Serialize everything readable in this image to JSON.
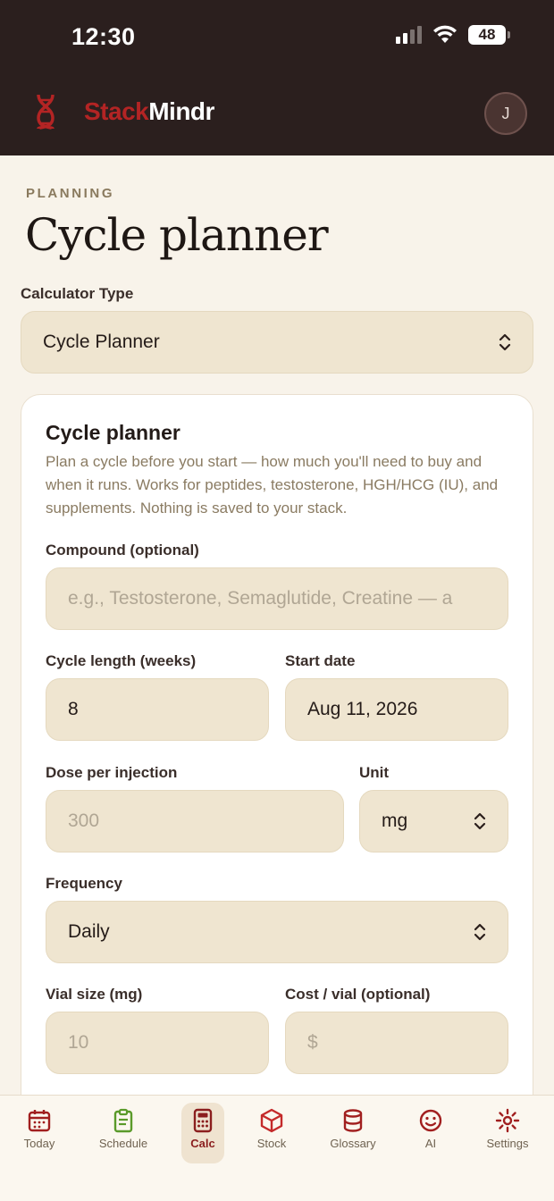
{
  "status": {
    "time": "12:30",
    "battery": "48"
  },
  "header": {
    "brand_part1": "Stack",
    "brand_part2": "Mindr",
    "avatar_initial": "J"
  },
  "page": {
    "eyebrow": "PLANNING",
    "title": "Cycle planner"
  },
  "calculator": {
    "label": "Calculator Type",
    "selected": "Cycle Planner"
  },
  "card": {
    "title": "Cycle planner",
    "description": "Plan a cycle before you start — how much you'll need to buy and when it runs. Works for peptides, testosterone, HGH/HCG (IU), and supplements. Nothing is saved to your stack."
  },
  "form": {
    "compound": {
      "label": "Compound (optional)",
      "placeholder": "e.g., Testosterone, Semaglutide, Creatine — a"
    },
    "cycle_length": {
      "label": "Cycle length (weeks)",
      "value": "8"
    },
    "start_date": {
      "label": "Start date",
      "value": "Aug 11, 2026"
    },
    "dose": {
      "label": "Dose per injection",
      "placeholder": "300"
    },
    "unit": {
      "label": "Unit",
      "selected": "mg"
    },
    "frequency": {
      "label": "Frequency",
      "selected": "Daily"
    },
    "vial_size": {
      "label": "Vial size (mg)",
      "placeholder": "10"
    },
    "cost": {
      "label": "Cost / vial (optional)",
      "placeholder": "$"
    }
  },
  "tabs": [
    {
      "label": "Today",
      "icon": "calendar-icon"
    },
    {
      "label": "Schedule",
      "icon": "clipboard-icon"
    },
    {
      "label": "Calc",
      "icon": "calculator-icon"
    },
    {
      "label": "Stock",
      "icon": "box-icon"
    },
    {
      "label": "Glossary",
      "icon": "database-icon"
    },
    {
      "label": "AI",
      "icon": "smiley-icon"
    },
    {
      "label": "Settings",
      "icon": "gear-icon"
    }
  ],
  "colors": {
    "header_bg": "#2b1f1e",
    "accent": "#b32424",
    "field_bg": "#efe5d0",
    "page_bg": "#f8f3ea"
  }
}
